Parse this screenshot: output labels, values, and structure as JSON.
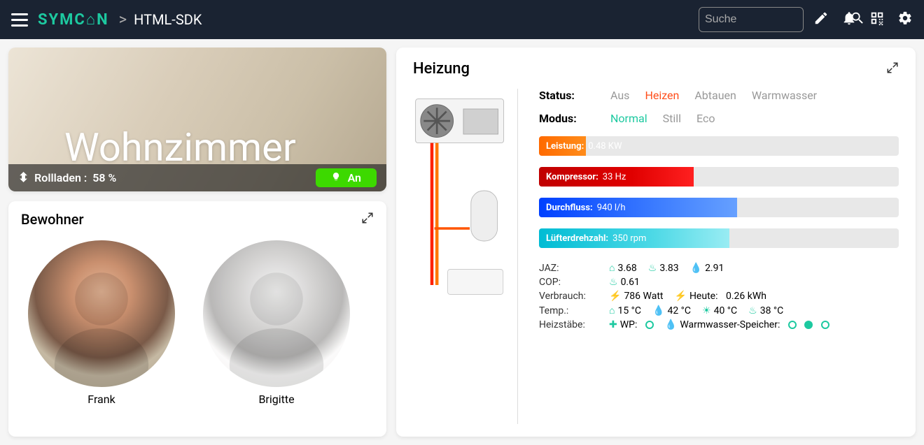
{
  "header": {
    "brand": "SYMC⌂N",
    "breadcrumb_chevron": ">",
    "page_title": "HTML-SDK",
    "search_placeholder": "Suche"
  },
  "room": {
    "name": "Wohnzimmer",
    "shutter_label": "Rollladen :",
    "shutter_value": "58 %",
    "light_label": "An"
  },
  "residents": {
    "title": "Bewohner",
    "list": [
      {
        "name": "Frank"
      },
      {
        "name": "Brigitte"
      }
    ]
  },
  "heating": {
    "title": "Heizung",
    "status_label": "Status:",
    "status_options": [
      "Aus",
      "Heizen",
      "Abtauen",
      "Warmwasser"
    ],
    "status_active": "Heizen",
    "mode_label": "Modus:",
    "mode_options": [
      "Normal",
      "Still",
      "Eco"
    ],
    "mode_active": "Normal",
    "bars": {
      "power": {
        "label": "Leistung:",
        "value": "0.48 KW"
      },
      "compressor": {
        "label": "Kompressor:",
        "value": "33 Hz"
      },
      "flow": {
        "label": "Durchfluss:",
        "value": "940 l/h"
      },
      "fan": {
        "label": "Lüfterdrehzahl:",
        "value": "350 rpm"
      }
    },
    "metrics": {
      "jaz_label": "JAZ:",
      "jaz_house": "3.68",
      "jaz_fire": "3.83",
      "jaz_drop": "2.91",
      "cop_label": "COP:",
      "cop_value": "0.61",
      "usage_label": "Verbrauch:",
      "usage_watts": "786 Watt",
      "usage_today_label": "Heute:",
      "usage_today_value": "0.26 kWh",
      "temp_label": "Temp.:",
      "temp_house": "15 °C",
      "temp_drop": "42 °C",
      "temp_sun": "40 °C",
      "temp_fire": "38 °C",
      "rods_label": "Heizstäbe:",
      "rods_wp": "WP:",
      "rods_ww": "Warmwasser-Speicher:"
    }
  }
}
